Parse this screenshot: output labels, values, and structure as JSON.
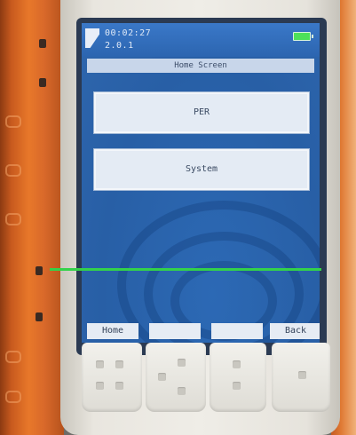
{
  "status": {
    "time": "00:02:27",
    "version": "2.0.1"
  },
  "header": {
    "title": "Home Screen"
  },
  "menu": {
    "items": [
      "PER",
      "System"
    ]
  },
  "softkeys": [
    "Home",
    "",
    "",
    "Back"
  ]
}
